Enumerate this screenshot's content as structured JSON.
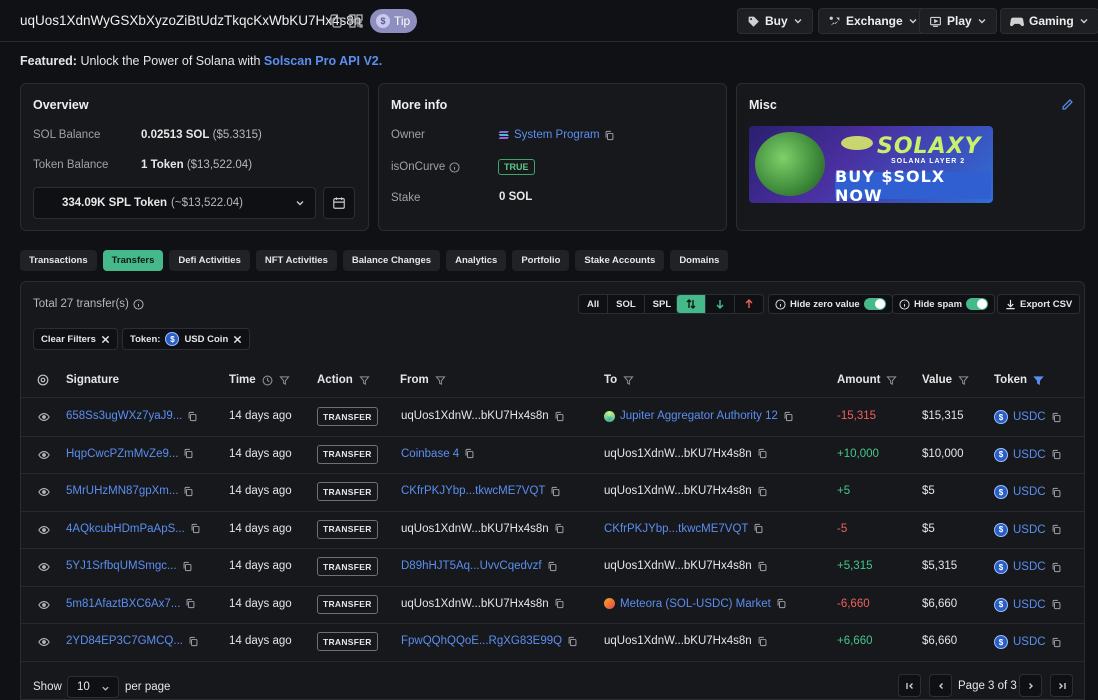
{
  "header": {
    "address": "uqUos1XdnWyGSXbXyzoZiBtUdzTkqcKxWbKU7Hx4s8n",
    "tip_label": "Tip",
    "menus": [
      {
        "label": "Buy",
        "icon": "tag-icon"
      },
      {
        "label": "Exchange",
        "icon": "exchange-icon"
      },
      {
        "label": "Play",
        "icon": "play-icon"
      },
      {
        "label": "Gaming",
        "icon": "gamepad-icon"
      }
    ]
  },
  "featured": {
    "prefix": "Featured:",
    "text": "Unlock the Power of Solana with",
    "link": "Solscan Pro API V2."
  },
  "overview": {
    "title": "Overview",
    "sol_balance_label": "SOL Balance",
    "sol_balance_value": "0.02513 SOL",
    "sol_balance_usd": "($5.3315)",
    "token_balance_label": "Token Balance",
    "token_balance_value": "1 Token",
    "token_balance_usd": "($13,522.04)",
    "token_select_value": "334.09K SPL Token",
    "token_select_usd": "(~$13,522.04)"
  },
  "more_info": {
    "title": "More info",
    "owner_label": "Owner",
    "owner_value": "System Program",
    "oncurve_label": "isOnCurve",
    "oncurve_value": "TRUE",
    "stake_label": "Stake",
    "stake_value": "0 SOL"
  },
  "misc": {
    "title": "Misc",
    "banner": {
      "brand": "SOLAXY",
      "tagline": "SOLANA LAYER 2",
      "cta": "BUY $SOLX NOW"
    }
  },
  "tabs": [
    "Transactions",
    "Transfers",
    "Defi Activities",
    "NFT Activities",
    "Balance Changes",
    "Analytics",
    "Portfolio",
    "Stake Accounts",
    "Domains"
  ],
  "active_tab": "Transfers",
  "toolbar": {
    "total": "Total 27 transfer(s)",
    "type_filters": [
      "All",
      "SOL",
      "SPL"
    ],
    "hide_zero_label": "Hide zero value",
    "hide_spam_label": "Hide spam",
    "export_label": "Export CSV"
  },
  "filters": {
    "clear_label": "Clear Filters",
    "token_label": "Token:",
    "token_value": "USD Coin"
  },
  "table": {
    "columns": [
      "Signature",
      "Time",
      "Action",
      "From",
      "To",
      "Amount",
      "Value",
      "Token"
    ],
    "rows": [
      {
        "signature": "658Ss3ugWXz7yaJ9...",
        "time": "14 days ago",
        "action": "TRANSFER",
        "from": "uqUos1XdnW...bKU7Hx4s8n",
        "from_link": false,
        "to": "Jupiter Aggregator Authority 12",
        "to_link": true,
        "to_icon": "jupiter",
        "amount": "-15,315",
        "sign": "neg",
        "value": "$15,315",
        "token": "USDC"
      },
      {
        "signature": "HqpCwcPZmMvZe9...",
        "time": "14 days ago",
        "action": "TRANSFER",
        "from": "Coinbase 4",
        "from_link": true,
        "to": "uqUos1XdnW...bKU7Hx4s8n",
        "to_link": false,
        "to_icon": "",
        "amount": "+10,000",
        "sign": "pos",
        "value": "$10,000",
        "token": "USDC"
      },
      {
        "signature": "5MrUHzMN87gpXm...",
        "time": "14 days ago",
        "action": "TRANSFER",
        "from": "CKfrPKJYbp...tkwcME7VQT",
        "from_link": true,
        "to": "uqUos1XdnW...bKU7Hx4s8n",
        "to_link": false,
        "to_icon": "",
        "amount": "+5",
        "sign": "pos",
        "value": "$5",
        "token": "USDC"
      },
      {
        "signature": "4AQkcubHDmPaApS...",
        "time": "14 days ago",
        "action": "TRANSFER",
        "from": "uqUos1XdnW...bKU7Hx4s8n",
        "from_link": false,
        "to": "CKfrPKJYbp...tkwcME7VQT",
        "to_link": true,
        "to_icon": "",
        "amount": "-5",
        "sign": "neg",
        "value": "$5",
        "token": "USDC"
      },
      {
        "signature": "5YJ1SrfbqUMSmgc...",
        "time": "14 days ago",
        "action": "TRANSFER",
        "from": "D89hHJT5Aq...UvvCqedvzf",
        "from_link": true,
        "to": "uqUos1XdnW...bKU7Hx4s8n",
        "to_link": false,
        "to_icon": "",
        "amount": "+5,315",
        "sign": "pos",
        "value": "$5,315",
        "token": "USDC"
      },
      {
        "signature": "5m81AfaztBXC6Ax7...",
        "time": "14 days ago",
        "action": "TRANSFER",
        "from": "uqUos1XdnW...bKU7Hx4s8n",
        "from_link": false,
        "to": "Meteora (SOL-USDC) Market",
        "to_link": true,
        "to_icon": "meteora",
        "amount": "-6,660",
        "sign": "neg",
        "value": "$6,660",
        "token": "USDC"
      },
      {
        "signature": "2YD84EP3C7GMCQ...",
        "time": "14 days ago",
        "action": "TRANSFER",
        "from": "FpwQQhQQoE...RgXG83E99Q",
        "from_link": true,
        "to": "uqUos1XdnW...bKU7Hx4s8n",
        "to_link": false,
        "to_icon": "",
        "amount": "+6,660",
        "sign": "pos",
        "value": "$6,660",
        "token": "USDC"
      }
    ]
  },
  "pagination": {
    "show_label": "Show",
    "per_page": "10",
    "per_page_label": "per page",
    "page_label": "Page 3 of 3"
  },
  "colors": {
    "accent": "#46b98a",
    "link": "#5b8ef0",
    "negative": "#f0605e",
    "positive": "#46c58a"
  }
}
